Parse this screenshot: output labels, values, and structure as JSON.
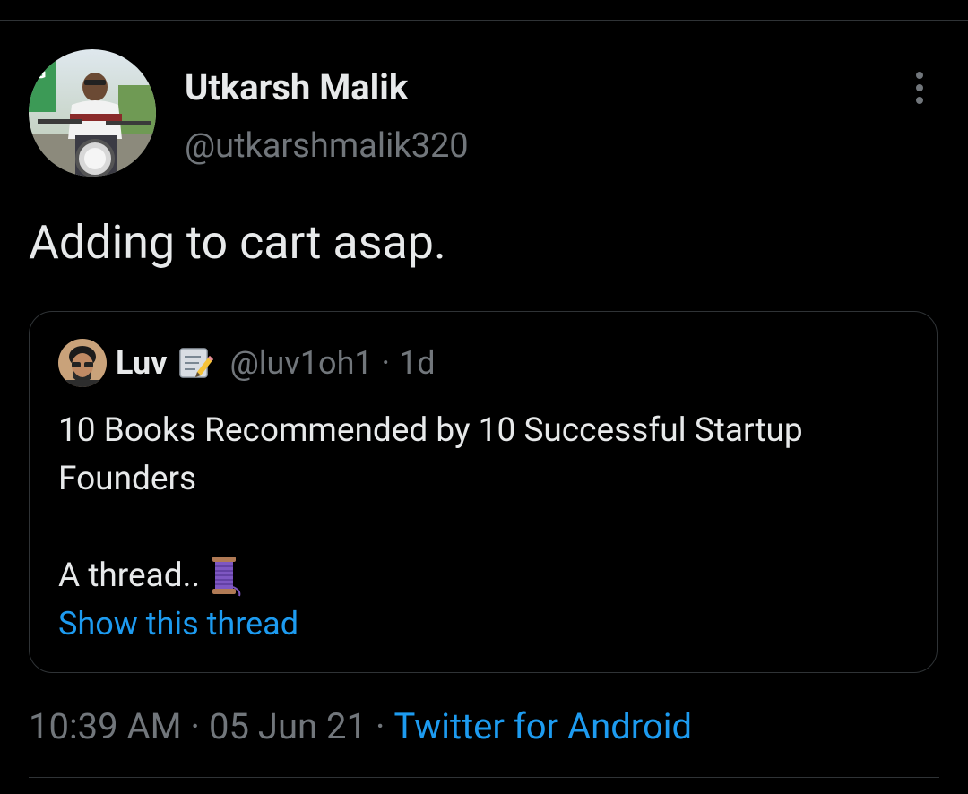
{
  "tweet": {
    "author": {
      "name": "Utkarsh Malik",
      "handle": "@utkarshmalik320"
    },
    "text": "Adding to cart asap.",
    "more_icon": "more-vertical-icon",
    "quoted": {
      "author": {
        "name": "Luv",
        "name_emoji": "memo-icon",
        "handle": "@luv1oh1"
      },
      "separator": "·",
      "time": "1d",
      "text_lines": [
        "10 Books Recommended by 10 Successful Startup",
        "Founders"
      ],
      "thread_text": "A thread..",
      "thread_emoji": "thread-spool-icon",
      "show_thread_label": "Show this thread"
    },
    "meta": {
      "time": "10:39 AM",
      "separator": "·",
      "date": "05 Jun 21",
      "source": "Twitter for Android"
    }
  },
  "colors": {
    "background": "#000000",
    "primary_text": "#e7e9ea",
    "secondary_text": "#71767b",
    "link": "#1d9bf0",
    "border": "#2f3336"
  }
}
